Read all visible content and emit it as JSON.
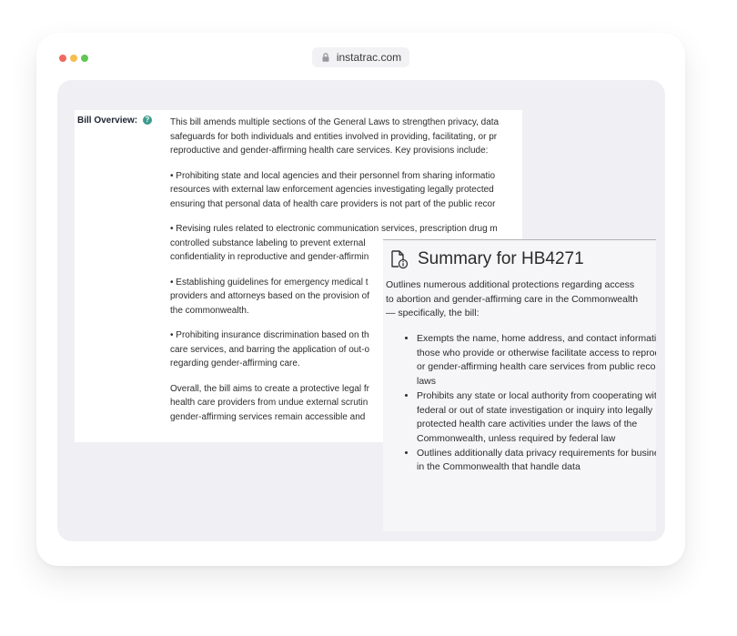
{
  "browser": {
    "url": "instatrac.com",
    "dot_colors": [
      "#ee6a5f",
      "#f5be4f",
      "#62c554"
    ]
  },
  "bill": {
    "label": "Bill Overview:",
    "help_symbol": "?",
    "paragraphs": [
      [
        "This bill amends multiple sections of the General Laws to strengthen privacy, data",
        "safeguards for both individuals and entities involved in providing, facilitating, or pr",
        "reproductive and gender-affirming health care services. Key provisions include:"
      ],
      [
        "• Prohibiting state and local agencies and their personnel from sharing informatio",
        "resources with external law enforcement agencies investigating legally protected",
        "ensuring that personal data of health care providers is not part of the public recor"
      ],
      [
        "• Revising rules related to electronic communication services, prescription drug m",
        "controlled substance labeling to prevent external",
        "confidentiality in reproductive and gender-affirmin"
      ],
      [
        "• Establishing guidelines for emergency medical t",
        "providers and attorneys based on the provision of",
        "the commonwealth."
      ],
      [
        "• Prohibiting insurance discrimination based on th",
        "care services, and barring the application of out-o",
        "regarding gender-affirming care."
      ],
      [
        "Overall, the bill aims to create a protective legal fr",
        "health care providers from undue external scrutin",
        "gender-affirming services remain accessible and"
      ]
    ]
  },
  "summary": {
    "title": "Summary for HB4271",
    "intro": "Outlines numerous additional protections regarding access to abortion and gender-affirming care in the Commonwealth — specifically, the bill:",
    "items": [
      "Exempts the name, home address, and contact information of those who provide or otherwise facilitate access to reproductive or gender-affirming health care services from public records laws",
      "Prohibits any state or local authority from cooperating with any federal or out of state investigation or inquiry into legally protected health care activities under the laws of the Commonwealth, unless required by federal law",
      "Outlines additionally data privacy requirements for businesses in the Commonwealth that handle data"
    ]
  }
}
